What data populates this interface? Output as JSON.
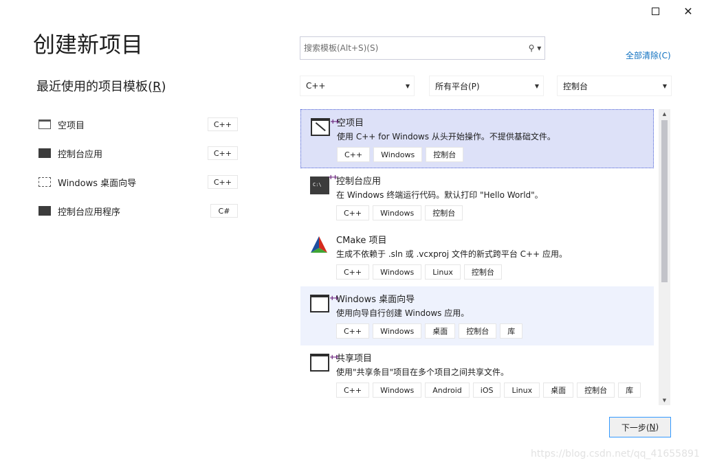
{
  "window": {
    "maximize_icon": "maximize-icon",
    "close_glyph": "✕"
  },
  "header": {
    "title": "创建新项目"
  },
  "recent": {
    "heading_text": "最近使用的项目模板(",
    "heading_key": "R",
    "heading_end": ")",
    "items": [
      {
        "label": "空项目",
        "lang": "C++",
        "icon": "empty-project-icon"
      },
      {
        "label": "控制台应用",
        "lang": "C++",
        "icon": "console-app-icon"
      },
      {
        "label": "Windows 桌面向导",
        "lang": "C++",
        "icon": "desktop-wizard-icon"
      },
      {
        "label": "控制台应用程序",
        "lang": "C#",
        "icon": "console-app-icon"
      }
    ]
  },
  "search": {
    "placeholder": "搜索模板(Alt+S)(S)",
    "icon": "search-icon"
  },
  "clear_all": "全部清除(C)",
  "filters": {
    "language": "C++",
    "platform": "所有平台(P)",
    "project_type": "控制台"
  },
  "templates": [
    {
      "name": "空项目",
      "desc": "使用 C++ for Windows 从头开始操作。不提供基础文件。",
      "tags": [
        "C++",
        "Windows",
        "控制台"
      ],
      "state": "selected"
    },
    {
      "name": "控制台应用",
      "desc": "在 Windows 终端运行代码。默认打印 \"Hello World\"。",
      "tags": [
        "C++",
        "Windows",
        "控制台"
      ],
      "state": "normal"
    },
    {
      "name": "CMake 项目",
      "desc": "生成不依赖于 .sln 或 .vcxproj 文件的新式跨平台 C++ 应用。",
      "tags": [
        "C++",
        "Windows",
        "Linux",
        "控制台"
      ],
      "state": "normal"
    },
    {
      "name": "Windows 桌面向导",
      "desc": "使用向导自行创建 Windows 应用。",
      "tags": [
        "C++",
        "Windows",
        "桌面",
        "控制台",
        "库"
      ],
      "state": "hovered"
    },
    {
      "name": "共享项目",
      "desc": "使用\"共享条目\"项目在多个项目之间共享文件。",
      "tags": [
        "C++",
        "Windows",
        "Android",
        "iOS",
        "Linux",
        "桌面",
        "控制台",
        "库"
      ],
      "state": "normal"
    }
  ],
  "next_button": {
    "text": "下一步(",
    "key": "N",
    "end": ")"
  },
  "watermark": "https://blog.csdn.net/qq_41655891"
}
